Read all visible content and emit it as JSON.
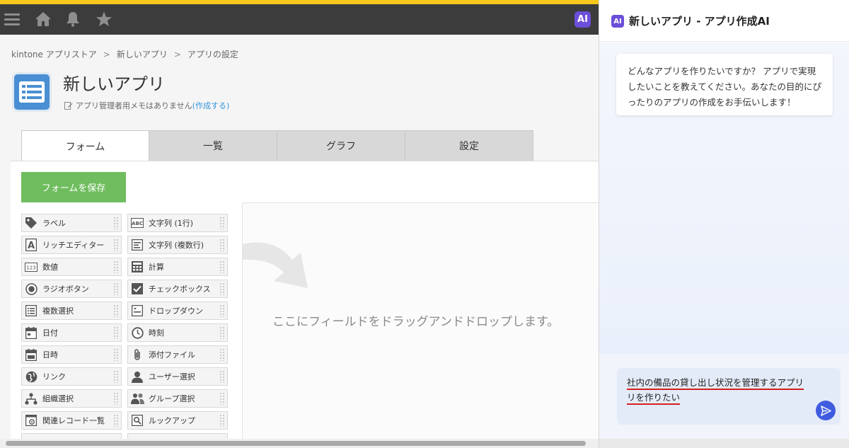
{
  "header": {
    "ai_badge": "AI",
    "accent_color": "#f7c719",
    "icons": [
      "hamburger-menu-icon",
      "home-icon",
      "bell-icon",
      "star-icon"
    ]
  },
  "breadcrumb": {
    "items": [
      "kintone アプリストア",
      "新しいアプリ",
      "アプリの設定"
    ],
    "separator": ">"
  },
  "app": {
    "title": "新しいアプリ",
    "memo_text": "アプリ管理者用メモはありません",
    "memo_link": "(作成する)",
    "icon_color": "#4a8fd3"
  },
  "tabs": [
    {
      "label": "フォーム",
      "active": true
    },
    {
      "label": "一覧",
      "active": false
    },
    {
      "label": "グラフ",
      "active": false
    },
    {
      "label": "設定",
      "active": false
    }
  ],
  "form": {
    "save_label": "フォームを保存",
    "save_color": "#6fbd5e",
    "drop_hint": "ここにフィールドをドラッグアンドドロップします。"
  },
  "fields": [
    {
      "label": "ラベル",
      "icon": "tag-icon"
    },
    {
      "label": "文字列 (1行)",
      "icon": "abc-icon"
    },
    {
      "label": "リッチエディター",
      "icon": "rich-text-icon"
    },
    {
      "label": "文字列 (複数行)",
      "icon": "multiline-icon"
    },
    {
      "label": "数値",
      "icon": "number-icon"
    },
    {
      "label": "計算",
      "icon": "calculator-icon"
    },
    {
      "label": "ラジオボタン",
      "icon": "radio-icon"
    },
    {
      "label": "チェックボックス",
      "icon": "checkbox-icon"
    },
    {
      "label": "複数選択",
      "icon": "multi-select-icon"
    },
    {
      "label": "ドロップダウン",
      "icon": "dropdown-icon"
    },
    {
      "label": "日付",
      "icon": "calendar-icon"
    },
    {
      "label": "時刻",
      "icon": "clock-icon"
    },
    {
      "label": "日時",
      "icon": "datetime-icon"
    },
    {
      "label": "添付ファイル",
      "icon": "paperclip-icon"
    },
    {
      "label": "リンク",
      "icon": "globe-icon"
    },
    {
      "label": "ユーザー選択",
      "icon": "user-icon"
    },
    {
      "label": "組織選択",
      "icon": "organization-icon"
    },
    {
      "label": "グループ選択",
      "icon": "group-icon"
    },
    {
      "label": "関連レコード一覧",
      "icon": "related-records-icon"
    },
    {
      "label": "ルックアップ",
      "icon": "lookup-icon"
    }
  ],
  "ai_panel": {
    "logo": "AI",
    "title": "新しいアプリ - アプリ作成AI",
    "message": "どんなアプリを作りたいですか？ アプリで実現したいことを教えてください。あなたの目的にぴったりのアプリの作成をお手伝いします！",
    "input_line1": "社内の備品の貸し出し状況を管理するアプリ",
    "input_line2": "リを作りたい",
    "send_icon": "send-icon",
    "accent_color": "#3f5ce0"
  }
}
